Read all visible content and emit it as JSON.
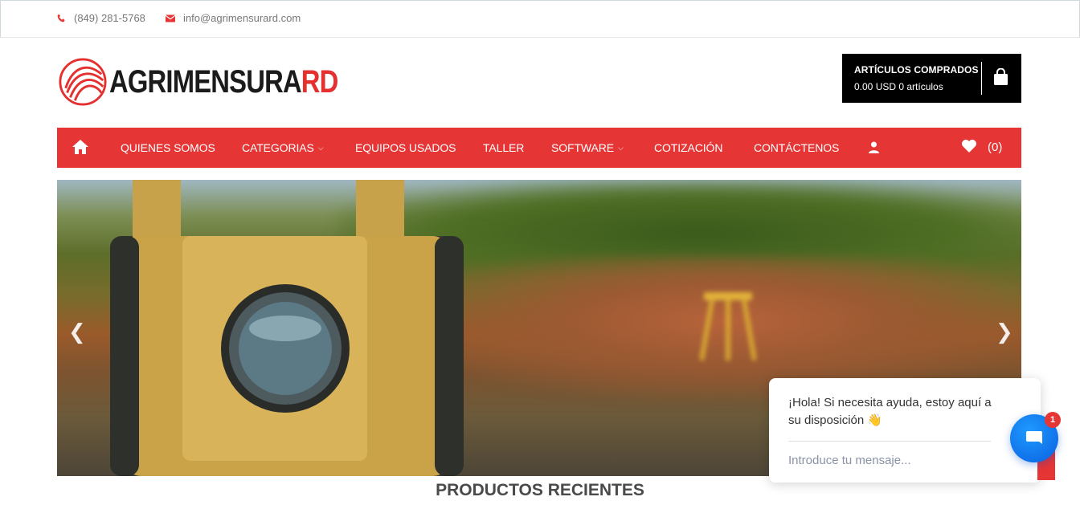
{
  "topbar": {
    "phone": "(849) 281-5768",
    "email": "info@agrimensurard.com"
  },
  "logo": {
    "text_dark": "AGRIMENSURA",
    "text_red": "RD"
  },
  "cart": {
    "title": "ARTÍCULOS COMPRADOS",
    "summary": "0.00 USD 0 artículos"
  },
  "nav": {
    "items": [
      {
        "label": "QUIENES SOMOS"
      },
      {
        "label": "CATEGORIAS"
      },
      {
        "label": "EQUIPOS USADOS"
      },
      {
        "label": "TALLER"
      },
      {
        "label": "SOFTWARE"
      },
      {
        "label": "COTIZACIÓN"
      },
      {
        "label": "CONTÁCTENOS"
      }
    ],
    "wishlist_count": "(0)"
  },
  "section_title": "PRODUCTOS RECIENTES",
  "chat": {
    "message": "¡Hola! Si necesita ayuda, estoy aquí a su disposición 👋",
    "input_placeholder": "Introduce tu mensaje...",
    "badge": "1"
  },
  "colors": {
    "accent": "#e53535",
    "cart_bg": "#000000",
    "chat_blue": "#1e88ff"
  }
}
